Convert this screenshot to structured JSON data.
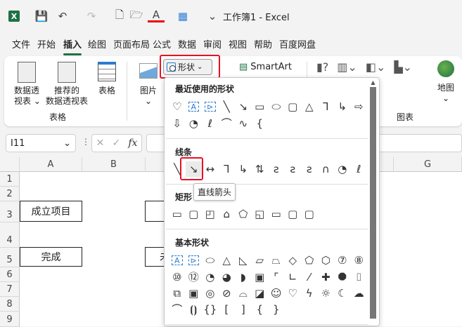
{
  "title": "工作簿1  -  Excel",
  "quick_access": [
    {
      "name": "excel-logo-icon",
      "glyph": "X"
    },
    {
      "name": "save-icon",
      "glyph": "💾"
    },
    {
      "name": "undo-icon",
      "glyph": "↶"
    },
    {
      "name": "redo-icon",
      "glyph": "↷"
    },
    {
      "name": "new-file-icon",
      "glyph": "🗋"
    },
    {
      "name": "open-folder-icon",
      "glyph": "🗁"
    },
    {
      "name": "font-color-icon",
      "glyph": "A"
    },
    {
      "name": "borders-icon",
      "glyph": "▦"
    },
    {
      "name": "customize-icon",
      "glyph": "⌄"
    }
  ],
  "menu_tabs": [
    "文件",
    "开始",
    "插入",
    "绘图",
    "页面布局",
    "公式",
    "数据",
    "审阅",
    "视图",
    "帮助",
    "百度网盘"
  ],
  "ribbon": {
    "pivot": "数据透\n视表 ⌄",
    "rec_pivot_1": "推荐的",
    "rec_pivot_2": "数据透视表",
    "table": "表格",
    "group_table": "表格",
    "picture": "图片",
    "shapes": "形状",
    "smartart": "SmartArt",
    "map": "地图",
    "group_charts": "图表"
  },
  "formula": {
    "name_box": "I11",
    "fx": "fx"
  },
  "columns": [
    "A",
    "B",
    "G"
  ],
  "rows": [
    "1",
    "2",
    "3",
    "4",
    "5",
    "6",
    "7",
    "8",
    "9"
  ],
  "cells": {
    "a3": "成立项目",
    "a5": "完成",
    "c5": "未"
  },
  "panel": {
    "recent": "最近使用的形状",
    "lines": "线条",
    "rect": "矩形",
    "basic": "基本形状",
    "tooltip": "直线箭头",
    "recent_rows": [
      [
        "♡",
        "A",
        "⊳",
        "╲",
        "↘",
        "▭",
        "⬭",
        "▢",
        "△",
        "⅂",
        "↳",
        "⇨"
      ],
      [
        "⇩",
        "◔",
        "ℓ",
        "⌒",
        "∿",
        "{"
      ]
    ],
    "lines_row": [
      "╲",
      "↘",
      "↔",
      "⅂",
      "↳",
      "⇅",
      "ƨ",
      "ƨ",
      "ƨ",
      "∩",
      "◔",
      "ℓ"
    ],
    "rect_row": [
      "▭",
      "▢",
      "◰",
      "⌂",
      "⬠",
      "◱",
      "▭",
      "▢",
      "▢"
    ],
    "basic_rows": [
      [
        "A",
        "⊳",
        "⬭",
        "△",
        "◺",
        "▱",
        "⏢",
        "◇",
        "⬠",
        "⬡",
        "⑦",
        "⑧"
      ],
      [
        "⑩",
        "⑫",
        "◔",
        "◕",
        "◗",
        "▣",
        "⌜",
        "∟",
        "⁄",
        "✚",
        "⯃",
        "⌷"
      ],
      [
        "⧉",
        "▣",
        "◎",
        "⊘",
        "⌓",
        "◪",
        "☺",
        "♡",
        "ϟ",
        "☼",
        "☾",
        "☁"
      ],
      [
        "⌒",
        "⦗⦘",
        "{}",
        "[",
        "]",
        "{",
        "}"
      ]
    ]
  },
  "colors": {
    "highlight": "#e81123",
    "accent": "#1e7145"
  }
}
